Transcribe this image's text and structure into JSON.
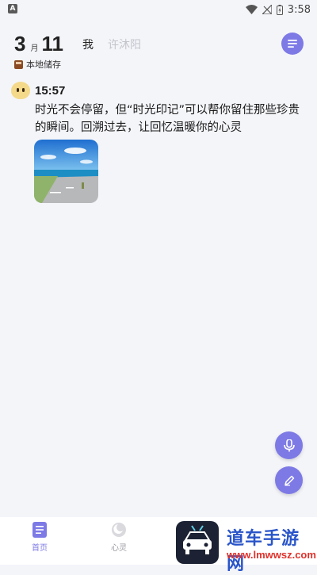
{
  "status_bar": {
    "app_badge": "A",
    "time": "3:58"
  },
  "header": {
    "month": "3",
    "month_unit": "月",
    "day": "11",
    "tab_me": "我",
    "tab_name": "许沐阳",
    "storage_label": "本地储存"
  },
  "entry": {
    "time": "15:57",
    "text": "时光不会停留，但“时光印记”可以帮你留住那些珍贵的瞬间。回溯过去，让回忆温暖你的心灵"
  },
  "nav": {
    "home_label": "首页",
    "soul_label": "心灵"
  },
  "watermark": {
    "title": "道车手游网",
    "url": "www.lmwwsz.com"
  },
  "colors": {
    "accent": "#7d7ae6",
    "background": "#f4f5f9"
  }
}
